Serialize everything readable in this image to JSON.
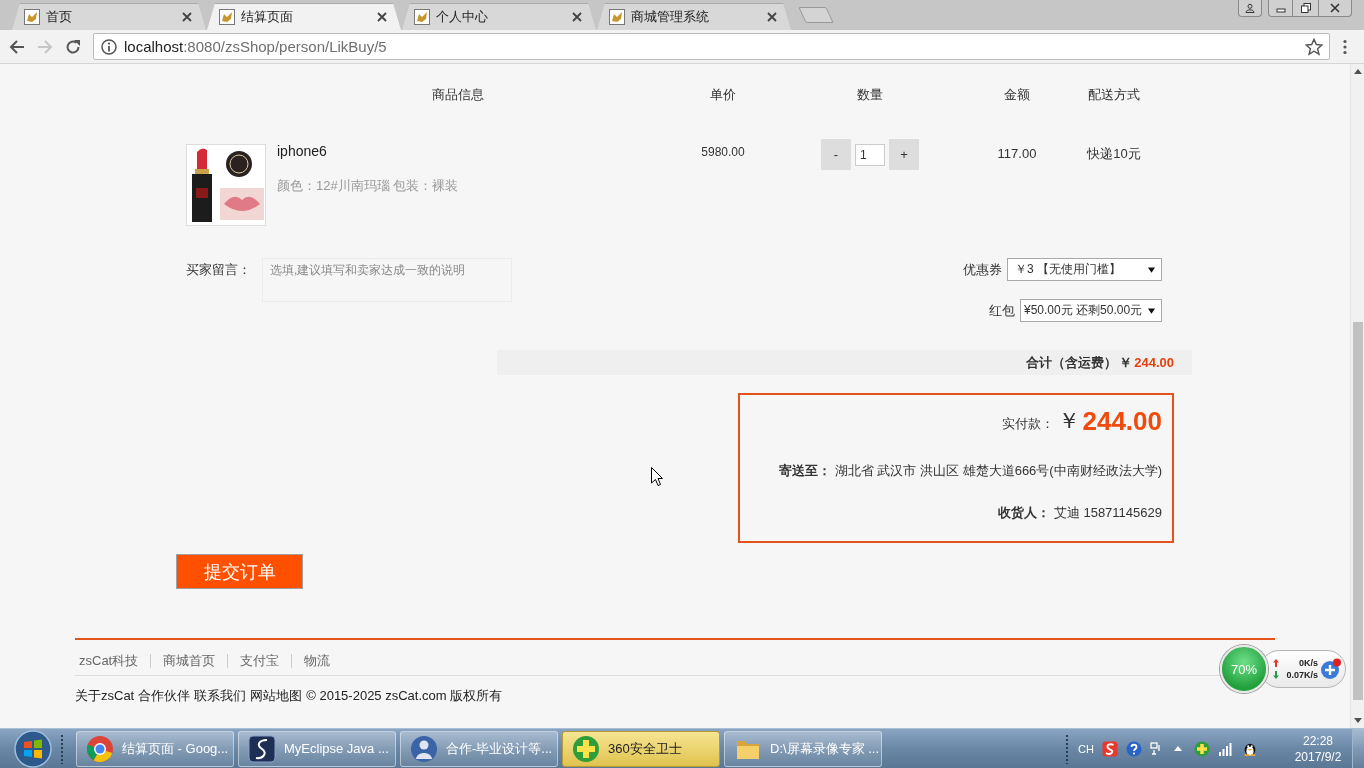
{
  "browser": {
    "tabs": [
      {
        "title": "首页",
        "selected": false
      },
      {
        "title": "结算页面",
        "selected": true
      },
      {
        "title": "个人中心",
        "selected": false
      },
      {
        "title": "商城管理系统",
        "selected": false
      }
    ],
    "nav_buttons": [
      {
        "kind": "back",
        "disabled": false
      },
      {
        "kind": "forward",
        "disabled": true
      },
      {
        "kind": "reload",
        "disabled": false
      }
    ],
    "address": {
      "host": "localhost",
      "path": ":8080/zsShop/person/LikBuy/5"
    }
  },
  "order": {
    "columns": [
      "商品信息",
      "单价",
      "数量",
      "金额",
      "配送方式"
    ],
    "items": [
      {
        "name": "iphone6",
        "spec": "颜色：12#川南玛瑙 包装：裸装",
        "price": "5980.00",
        "decrease": "-",
        "quantity": "1",
        "increase": "+",
        "amount": "117.00",
        "shipping": "快递10元"
      }
    ],
    "message": {
      "label": "买家留言：",
      "placeholder": "选填,建议填写和卖家达成一致的说明"
    },
    "discounts": [
      {
        "label": "优惠券",
        "value": "￥3 【无使用门槛】"
      },
      {
        "label": "红包",
        "value": "¥50.00元 还剩50.00元"
      }
    ],
    "total": {
      "label": "合计（含运费）",
      "currency": "￥",
      "amount": "244.00"
    },
    "summary": {
      "pay_label": "实付款：",
      "currency": "￥",
      "pay_amount": "244.00",
      "address_label": "寄送至：",
      "address": "湖北省 武汉市 洪山区 雄楚大道666号(中南财经政法大学)",
      "receiver_label": "收货人：",
      "receiver": "艾迪 15871145629"
    },
    "submit": "提交订单"
  },
  "footer": {
    "links": [
      "zsCat科技",
      "商城首页",
      "支付宝",
      "物流"
    ],
    "bottom_links": [
      "关于zsCat",
      "合作伙伴",
      "联系我们",
      "网站地图"
    ],
    "copyright": "© 2015-2025 zsCat.com 版权所有"
  },
  "speed_widget": {
    "percent": "70%",
    "upload": "0K/s",
    "download": "0.07K/s"
  },
  "taskbar": {
    "tasks": [
      {
        "kind": "browser",
        "title": "结算页面 - Goog...",
        "flashing": false
      },
      {
        "kind": "ide",
        "title": "MyEclipse Java ...",
        "flashing": false
      },
      {
        "kind": "avatar",
        "title": "合作-毕业设计等...",
        "flashing": false
      },
      {
        "kind": "security",
        "title": "360安全卫士",
        "flashing": true
      },
      {
        "kind": "folder",
        "title": "D:\\屏幕录像专家 ...",
        "flashing": false
      }
    ],
    "language": "CH",
    "time": "22:28",
    "date": "2017/9/2"
  }
}
